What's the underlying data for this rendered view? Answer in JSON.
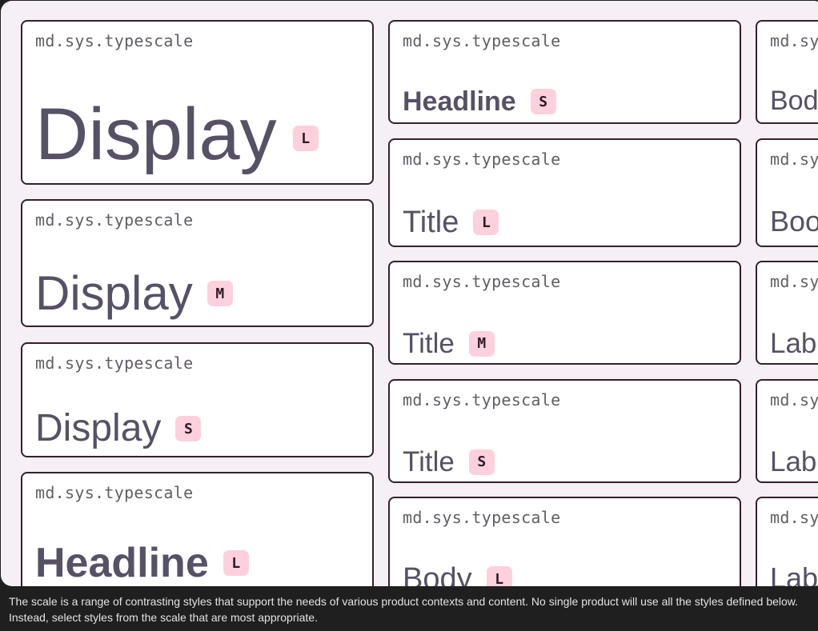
{
  "cards": [
    {
      "token": "md.sys.typescale",
      "name": "Display",
      "size": "L"
    },
    {
      "token": "md.sys.typescale",
      "name": "Display",
      "size": "M"
    },
    {
      "token": "md.sys.typescale",
      "name": "Display",
      "size": "S"
    },
    {
      "token": "md.sys.typescale",
      "name": "Headline",
      "size": "L"
    },
    {
      "token": "md.sys.typescale",
      "name": "Headline",
      "size": "S"
    },
    {
      "token": "md.sys.typescale",
      "name": "Title",
      "size": "L"
    },
    {
      "token": "md.sys.typescale",
      "name": "Title",
      "size": "M"
    },
    {
      "token": "md.sys.typescale",
      "name": "Title",
      "size": "S"
    },
    {
      "token": "md.sys.typescale",
      "name": "Body",
      "size": "L"
    },
    {
      "token": "md.sy",
      "name": "Bod"
    },
    {
      "token": "md.sy",
      "name": "Boo"
    },
    {
      "token": "md.sy",
      "name": "Labe"
    },
    {
      "token": "md.sy",
      "name": "Labe"
    },
    {
      "token": "md.sy",
      "name": "Lab"
    }
  ],
  "caption": "The scale is a range of contrasting styles that support the needs of various product contexts and content. No single product will use all the styles defined below. Instead, select styles from the scale that are most appropriate.",
  "colors": {
    "panel_bg": "#f6eff6",
    "card_border": "#35202c",
    "sample_text": "#575166",
    "badge_bg": "#fdd0dd",
    "caption_bg": "#1f1f1f"
  }
}
